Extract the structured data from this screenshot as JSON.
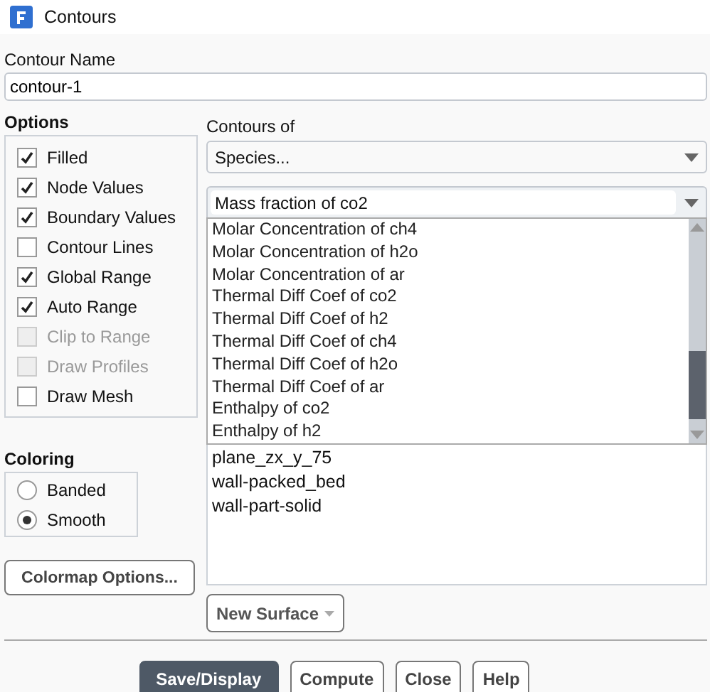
{
  "window": {
    "title": "Contours"
  },
  "contour_name": {
    "label": "Contour Name",
    "value": "contour-1"
  },
  "options": {
    "title": "Options",
    "items": [
      {
        "label": "Filled",
        "checked": true,
        "disabled": false
      },
      {
        "label": "Node Values",
        "checked": true,
        "disabled": false
      },
      {
        "label": "Boundary Values",
        "checked": true,
        "disabled": false
      },
      {
        "label": "Contour Lines",
        "checked": false,
        "disabled": false
      },
      {
        "label": "Global Range",
        "checked": true,
        "disabled": false
      },
      {
        "label": "Auto Range",
        "checked": true,
        "disabled": false
      },
      {
        "label": "Clip to Range",
        "checked": false,
        "disabled": true
      },
      {
        "label": "Draw Profiles",
        "checked": false,
        "disabled": true
      },
      {
        "label": "Draw Mesh",
        "checked": false,
        "disabled": false
      }
    ]
  },
  "contours_of": {
    "label": "Contours of",
    "category": {
      "value": "Species..."
    },
    "field": {
      "value": "Mass fraction of co2",
      "expanded": true
    },
    "dropdown_items": [
      "Molar Concentration of ch4",
      "Molar Concentration of h2o",
      "Molar Concentration of ar",
      "Thermal Diff Coef of co2",
      "Thermal Diff Coef of h2",
      "Thermal Diff Coef of ch4",
      "Thermal Diff Coef of h2o",
      "Thermal Diff Coef of ar",
      "Enthalpy of co2",
      "Enthalpy of h2"
    ]
  },
  "coloring": {
    "title": "Coloring",
    "items": [
      {
        "label": "Banded",
        "selected": false
      },
      {
        "label": "Smooth",
        "selected": true
      }
    ]
  },
  "colormap_button": "Colormap Options...",
  "surfaces": [
    "plane_zx_y_75",
    "wall-packed_bed",
    "wall-part-solid"
  ],
  "new_surface_button": "New Surface",
  "buttons": [
    {
      "label": "Save/Display",
      "kind": "primary"
    },
    {
      "label": "Compute",
      "kind": "normal"
    },
    {
      "label": "Close",
      "kind": "normal"
    },
    {
      "label": "Help",
      "kind": "normal"
    }
  ]
}
